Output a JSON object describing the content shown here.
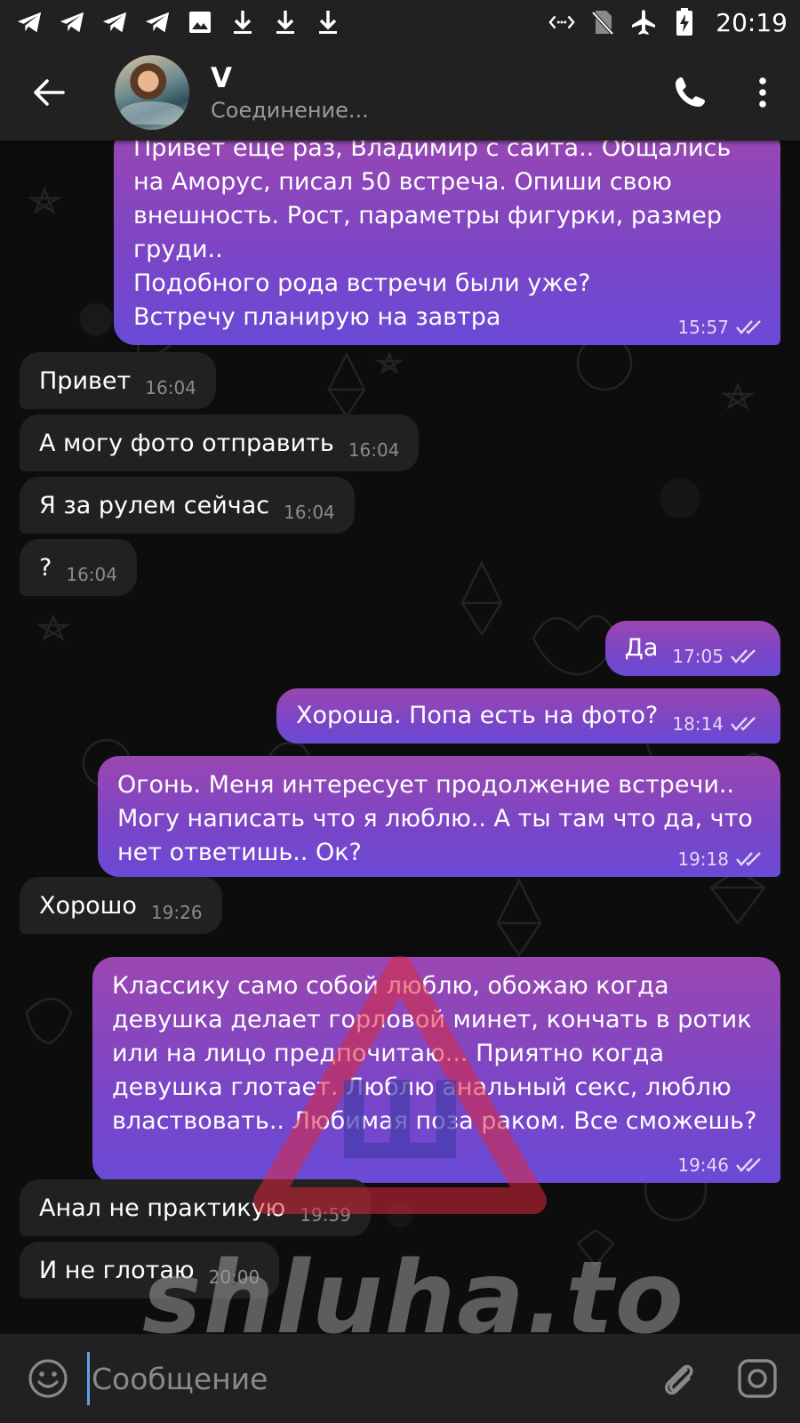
{
  "status_bar": {
    "time": "20:19",
    "left_icons": [
      "telegram-icon",
      "telegram-icon",
      "telegram-icon",
      "telegram-icon",
      "image-icon",
      "download-icon",
      "download-icon",
      "download-icon"
    ],
    "right_icons": [
      "data-transfer-icon",
      "no-sim-icon",
      "airplane-icon",
      "battery-charging-icon"
    ]
  },
  "header": {
    "contact_name": "V",
    "contact_status": "Соединение..."
  },
  "messages": [
    {
      "dir": "out",
      "text": "Привет еще раз, Владимир с сайта.. Общались на Аморус, писал 50 встреча. Опиши свою внешность. Рост, параметры фигурки, размер груди..\nПодобного рода встречи были уже?\nВстречу планирую на завтра",
      "time": "15:57"
    },
    {
      "dir": "in",
      "text": "Привет",
      "time": "16:04"
    },
    {
      "dir": "in",
      "text": "А могу фото отправить",
      "time": "16:04"
    },
    {
      "dir": "in",
      "text": "Я за рулем сейчас",
      "time": "16:04"
    },
    {
      "dir": "in",
      "text": "?",
      "time": "16:04"
    },
    {
      "dir": "out",
      "text": "Да",
      "time": "17:05"
    },
    {
      "dir": "out",
      "text": "Хороша. Попа есть на фото?",
      "time": "18:14"
    },
    {
      "dir": "out",
      "text": "Огонь. Меня интересует продолжение встречи.. Могу написать что я люблю.. А ты там что да, что нет ответишь.. Ок?",
      "time": "19:18"
    },
    {
      "dir": "in",
      "text": "Хорошо",
      "time": "19:26"
    },
    {
      "dir": "out",
      "text": "Классику само собой люблю, обожаю когда девушка делает горловой минет, кончать в ротик или на лицо предпочитаю... Приятно когда девушка глотает. Люблю анальный секс, люблю властвовать.. Любимая поза раком. Все сможешь?",
      "time": "19:46"
    },
    {
      "dir": "in",
      "text": "Анал не практикую",
      "time": "19:59"
    },
    {
      "dir": "in",
      "text": "И не глотаю",
      "time": "20:00"
    }
  ],
  "watermark": {
    "letter": "Ш",
    "text": "shluha.to"
  },
  "input": {
    "placeholder": "Сообщение"
  },
  "colors": {
    "outgoing_top": "#9a47b1",
    "outgoing_bottom": "#6a4ad6",
    "incoming": "#212121",
    "bars": "#212121",
    "cursor": "#5fa3e6"
  }
}
